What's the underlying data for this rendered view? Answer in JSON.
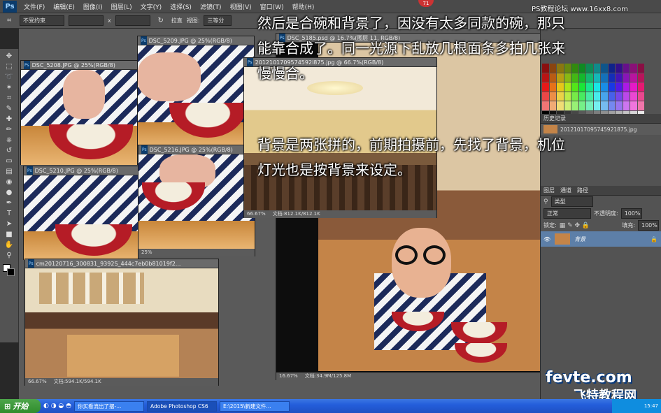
{
  "app": {
    "logo": "Ps",
    "menu": [
      "文件(F)",
      "编辑(E)",
      "图像(I)",
      "图层(L)",
      "文字(Y)",
      "选择(S)",
      "滤镜(T)",
      "视图(V)",
      "窗口(W)",
      "帮助(H)"
    ]
  },
  "options": {
    "style_value": "不受约束",
    "x_label": "x",
    "straighten": "拉直",
    "view_label": "视图:",
    "view_value": "三等分"
  },
  "tools": [
    "move-icon",
    "marquee-icon",
    "lasso-icon",
    "magic-wand-icon",
    "crop-icon",
    "eyedropper-icon",
    "healing-icon",
    "brush-icon",
    "stamp-icon",
    "history-brush-icon",
    "eraser-icon",
    "gradient-icon",
    "blur-icon",
    "dodge-icon",
    "pen-icon",
    "type-icon",
    "path-select-icon",
    "shape-icon",
    "hand-icon",
    "zoom-icon"
  ],
  "documents": [
    {
      "title": "DSC_5208.JPG @ 25%(RGB/8)"
    },
    {
      "title": "DSC_5209.JPG @ 25%(RGB/8)"
    },
    {
      "title": "DSC_5216.JPG @ 25%(RGB/8)",
      "zoom": "25%"
    },
    {
      "title": "DSC_5210.JPG @ 25%(RGB/8)"
    },
    {
      "title": "cm20120716_300831_9392S_444c7eb0b81019f2...",
      "zoom": "66.67%",
      "doc": "文档:594.1K/594.1K"
    },
    {
      "title": "2012101709574592l875.jpg @ 66.7%(RGB/8)",
      "zoom": "66.67%",
      "doc": "文档:812.1K/812.1K"
    },
    {
      "title": "DSC_5185.psd @ 16.7%(图层 11, RGB/8)",
      "zoom": "16.67%",
      "doc": "文档:34.9M/125.8M"
    }
  ],
  "captions": {
    "line1": "然后是合碗和背景了，因没有太多同款的碗，那只",
    "line2": "能靠合成了。同一光源下乱放几根面条多拍几张来",
    "line3": "慢慢合。",
    "line4": "背景是两张拼的，前期拍摄前，先找了背景，机位",
    "line5": "灯光也是按背景来设定。"
  },
  "panels": {
    "history_tab": "历史记录",
    "history_item": "20121017095745921875.jpg",
    "layers_tabs": [
      "图层",
      "通道",
      "路径"
    ],
    "kind_label": "类型",
    "blend_mode": "正常",
    "opacity_label": "不透明度:",
    "opacity_value": "100%",
    "lock_label": "锁定:",
    "fill_label": "填充:",
    "fill_value": "100%",
    "layer_name": "背景"
  },
  "taskbar": {
    "start": "开始",
    "items": [
      "你买看流出了摺-...",
      "Adobe Photoshop CS6",
      "E:\\2015\\新建文件..."
    ],
    "clock": "15:47"
  },
  "watermarks": {
    "top": "PS教程论坛 www.16xx8.com",
    "badge": "71",
    "logo": "fevte.com",
    "logo_cn": "飞特教程网"
  },
  "colors": {
    "accent": "#0c3c6c",
    "bowl_red": "#b51c26",
    "taskbar_blue": "#245edb",
    "start_green": "#2f8c2c"
  }
}
